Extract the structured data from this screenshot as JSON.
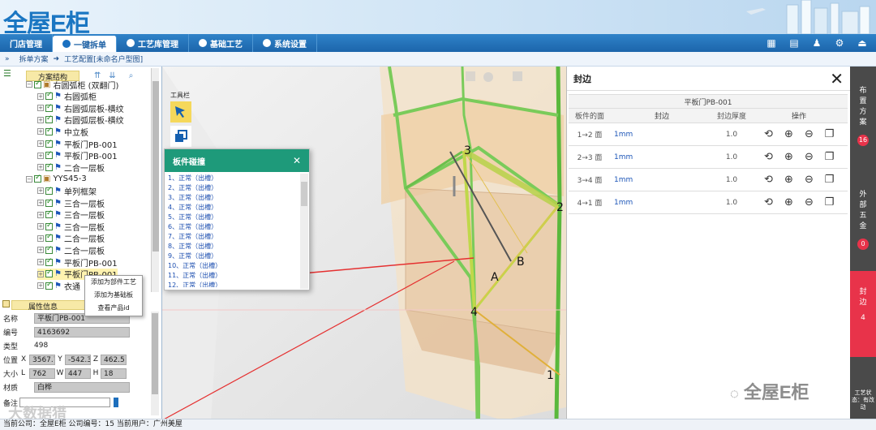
{
  "app": {
    "logo": "全屋E柜"
  },
  "nav": {
    "tabs": [
      {
        "label": "门店管理"
      },
      {
        "label": "一键拆单"
      },
      {
        "label": "工艺库管理"
      },
      {
        "label": "基础工艺"
      },
      {
        "label": "系统设置"
      }
    ],
    "icons": [
      "calculator-icon",
      "document-icon",
      "users-icon",
      "gear-icon",
      "logout-icon"
    ]
  },
  "breadcrumb": {
    "a": "拆单方案",
    "b": "工艺配置[未命名户型图]"
  },
  "tree": {
    "title": "方案结构",
    "items": [
      {
        "label": "右圆弧柜 (双翻门)",
        "level": 0,
        "icon": "box"
      },
      {
        "label": "右圆弧柜",
        "level": 1,
        "icon": "flag"
      },
      {
        "label": "右圆弧层板-横纹",
        "level": 1,
        "icon": "flag"
      },
      {
        "label": "右圆弧层板-横纹",
        "level": 1,
        "icon": "flag"
      },
      {
        "label": "中立板",
        "level": 1,
        "icon": "flag"
      },
      {
        "label": "平板门PB-001",
        "level": 1,
        "icon": "flag"
      },
      {
        "label": "平板门PB-001",
        "level": 1,
        "icon": "flag"
      },
      {
        "label": "二合一层板",
        "level": 1,
        "icon": "flag"
      },
      {
        "label": "YYS45-3",
        "level": 0,
        "icon": "box"
      },
      {
        "label": "单列框架",
        "level": 1,
        "icon": "flag"
      },
      {
        "label": "三合一层板",
        "level": 1,
        "icon": "flag"
      },
      {
        "label": "三合一层板",
        "level": 1,
        "icon": "flag"
      },
      {
        "label": "三合一层板",
        "level": 1,
        "icon": "flag"
      },
      {
        "label": "二合一层板",
        "level": 1,
        "icon": "flag"
      },
      {
        "label": "二合一层板",
        "level": 1,
        "icon": "flag"
      },
      {
        "label": "平板门PB-001",
        "level": 1,
        "icon": "flag"
      },
      {
        "label": "平板门PB-001",
        "level": 1,
        "icon": "flag",
        "selected": true
      },
      {
        "label": "衣通",
        "level": 1,
        "icon": "flag"
      }
    ]
  },
  "context_menu": {
    "items": [
      "添加为部件工艺",
      "添加为基础板",
      "查看产品id"
    ]
  },
  "attributes": {
    "title": "属性信息",
    "name_label": "名称",
    "name": "平板门PB-001",
    "code_label": "编号",
    "code": "4163692",
    "type_label": "类型",
    "type": "498",
    "pos_label": "位置",
    "x": "3567.7",
    "y": "-542.3",
    "z": "462.5",
    "size_label": "大小",
    "l": "762",
    "w": "447",
    "h": "18",
    "material_label": "材质",
    "material": "白桦",
    "remark_label": "备注"
  },
  "toolbar": {
    "label": "工具栏"
  },
  "collision": {
    "title": "板件碰撞",
    "items": [
      "1、正常（出槽）",
      "2、正常（出槽）",
      "3、正常（出槽）",
      "4、正常（出槽）",
      "5、正常（出槽）",
      "6、正常（出槽）",
      "7、正常（出槽）",
      "8、正常（出槽）",
      "9、正常（出槽）",
      "10、正常（出槽）",
      "11、正常（出槽）",
      "12、正常（出槽）"
    ]
  },
  "viewport": {
    "labels": [
      "1",
      "2",
      "3",
      "4",
      "A",
      "B"
    ]
  },
  "edge_panel": {
    "title": "封边",
    "part": "平板门PB-001",
    "headers": [
      "板件的面",
      "封边",
      "封边厚度",
      "操作"
    ],
    "rows": [
      {
        "face": "1→2 面",
        "edge": "1mm",
        "thickness": "1.0"
      },
      {
        "face": "2→3 面",
        "edge": "1mm",
        "thickness": "1.0"
      },
      {
        "face": "3→4 面",
        "edge": "1mm",
        "thickness": "1.0"
      },
      {
        "face": "4→1 面",
        "edge": "1mm",
        "thickness": "1.0"
      }
    ]
  },
  "right_bar": {
    "a": "布置方案",
    "a_count": "16",
    "b": "外部五金",
    "b_count": "0",
    "c": "封边",
    "c_count": "4",
    "d": "工艺状态：有改动"
  },
  "status": {
    "text": "当前公司：全屋E柜  公司编号：15  当前用户：广州美屋"
  },
  "watermark": {
    "a": "全屋E柜",
    "b": "大数据猎"
  },
  "colors": {
    "accent": "#1d6fbd",
    "popup": "#1e9a7a",
    "edge_active": "#e8334a"
  }
}
